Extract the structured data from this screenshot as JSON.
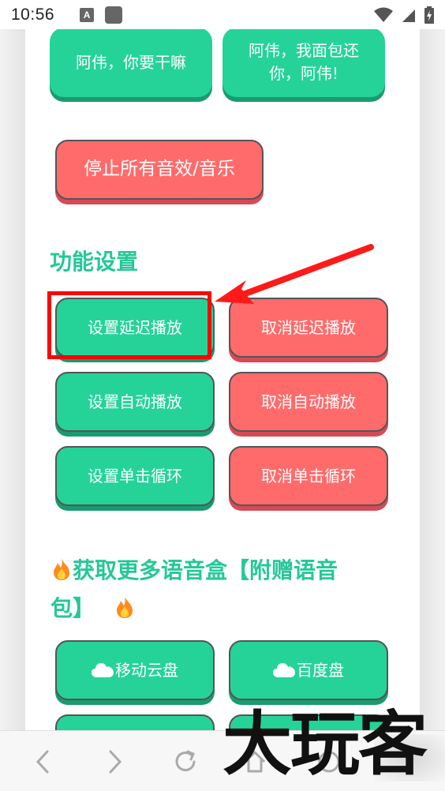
{
  "status_bar": {
    "time": "10:56",
    "notification_letter": "A"
  },
  "top_buttons": [
    {
      "label": "阿伟，你要干嘛",
      "color": "#25d399"
    },
    {
      "label": "阿伟，我面包还\n你，阿伟!",
      "color": "#25d399"
    }
  ],
  "stop_button": {
    "label": "停止所有音效/音乐",
    "color": "#ff6b6b"
  },
  "settings": {
    "title": "功能设置",
    "buttons": [
      {
        "label": "设置延迟播放",
        "color": "#25d399"
      },
      {
        "label": "取消延迟播放",
        "color": "#ff6b6b"
      },
      {
        "label": "设置自动播放",
        "color": "#25d399"
      },
      {
        "label": "取消自动播放",
        "color": "#ff6b6b"
      },
      {
        "label": "设置单击循环",
        "color": "#25d399"
      },
      {
        "label": "取消单击循环",
        "color": "#ff6b6b"
      }
    ]
  },
  "more": {
    "title_line1": "获取更多语音盒【附赠语音",
    "title_line2": "包】",
    "buttons": [
      {
        "label": "移动云盘",
        "icon": "cloud-icon"
      },
      {
        "label": "百度盘",
        "icon": "cloud-icon"
      }
    ]
  },
  "annotation": {
    "highlight_color": "#ff0000"
  },
  "watermark": {
    "text": "大玩客"
  },
  "colors": {
    "accent_green": "#25d399",
    "accent_red": "#ff6b6b",
    "title_green": "#25c898"
  }
}
